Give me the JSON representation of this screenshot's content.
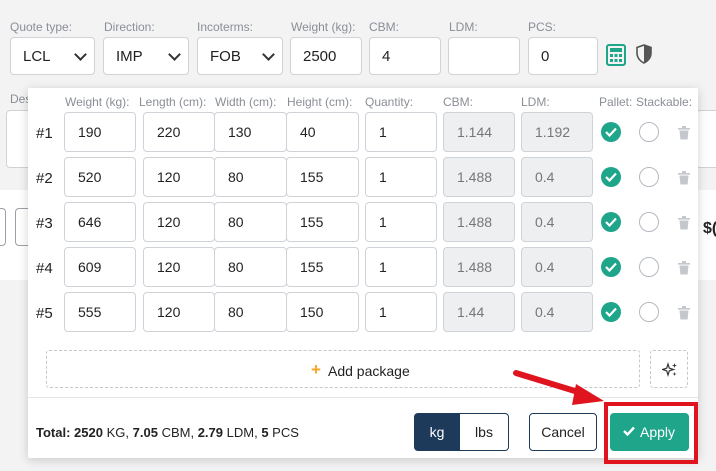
{
  "form": {
    "quote_type": {
      "label": "Quote type:",
      "value": "LCL"
    },
    "direction": {
      "label": "Direction:",
      "value": "IMP"
    },
    "incoterms": {
      "label": "Incoterms:",
      "value": "FOB"
    },
    "weight": {
      "label": "Weight (kg):",
      "value": "2500"
    },
    "cbm": {
      "label": "CBM:",
      "value": "4"
    },
    "ldm": {
      "label": "LDM:",
      "value": ""
    },
    "pcs": {
      "label": "PCS:",
      "value": "0"
    },
    "description_label": "Des",
    "partial_price": "$("
  },
  "packages": {
    "columns": {
      "weight": "Weight (kg):",
      "length": "Length (cm):",
      "width": "Width (cm):",
      "height": "Height (cm):",
      "quantity": "Quantity:",
      "cbm": "CBM:",
      "ldm": "LDM:",
      "pallet": "Pallet:",
      "stackable": "Stackable:"
    },
    "rows": [
      {
        "label": "#1",
        "weight": "190",
        "length": "220",
        "width": "130",
        "height": "40",
        "quantity": "1",
        "cbm": "1.144",
        "ldm": "1.192",
        "pallet": true,
        "stackable": false
      },
      {
        "label": "#2",
        "weight": "520",
        "length": "120",
        "width": "80",
        "height": "155",
        "quantity": "1",
        "cbm": "1.488",
        "ldm": "0.4",
        "pallet": true,
        "stackable": false
      },
      {
        "label": "#3",
        "weight": "646",
        "length": "120",
        "width": "80",
        "height": "155",
        "quantity": "1",
        "cbm": "1.488",
        "ldm": "0.4",
        "pallet": true,
        "stackable": false
      },
      {
        "label": "#4",
        "weight": "609",
        "length": "120",
        "width": "80",
        "height": "155",
        "quantity": "1",
        "cbm": "1.488",
        "ldm": "0.4",
        "pallet": true,
        "stackable": false
      },
      {
        "label": "#5",
        "weight": "555",
        "length": "120",
        "width": "80",
        "height": "150",
        "quantity": "1",
        "cbm": "1.44",
        "ldm": "0.4",
        "pallet": true,
        "stackable": false
      }
    ],
    "add_label": "Add package"
  },
  "footer": {
    "total_prefix": "Total:",
    "total_kg": "2520",
    "kg_unit": "KG,",
    "total_cbm": "7.05",
    "cbm_unit": "CBM,",
    "total_ldm": "2.79",
    "ldm_unit": "LDM,",
    "total_pcs": "5",
    "pcs_unit": "PCS",
    "unit_kg": "kg",
    "unit_lbs": "lbs",
    "selected_unit": "kg",
    "cancel": "Cancel",
    "apply": "Apply"
  },
  "colors": {
    "accent_green": "#1fa58a",
    "navy": "#1e3a5a",
    "highlight_red": "#e0141e",
    "plus_orange": "#f5a623"
  }
}
